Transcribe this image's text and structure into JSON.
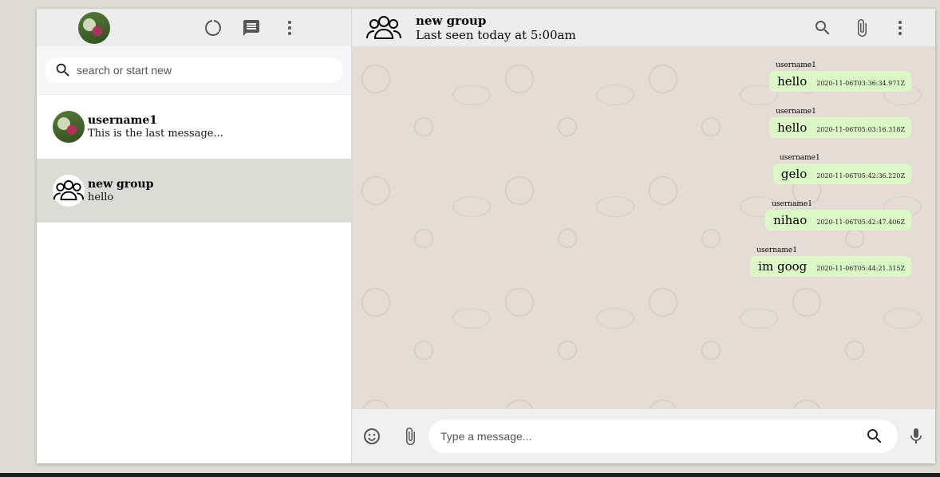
{
  "sidebar": {
    "search": {
      "placeholder": "search or start new"
    },
    "chats": [
      {
        "name": "username1",
        "last_message": "This is the last message..."
      },
      {
        "name": "new group",
        "last_message": "hello"
      }
    ]
  },
  "conversation": {
    "title": "new group",
    "status": "Last seen today at 5:00am",
    "messages": [
      {
        "user": "username1",
        "text": "hello",
        "time": "2020-11-06T03:36:34.971Z"
      },
      {
        "user": "username1",
        "text": "hello",
        "time": "2020-11-06T05:03:16.318Z"
      },
      {
        "user": "username1",
        "text": "gelo",
        "time": "2020-11-06T05:42:36.220Z"
      },
      {
        "user": "username1",
        "text": "nihao",
        "time": "2020-11-06T05:42:47.406Z"
      },
      {
        "user": "username1",
        "text": "im goog",
        "time": "2020-11-06T05:44:21.315Z"
      }
    ]
  },
  "composer": {
    "placeholder": "Type a message..."
  },
  "colors": {
    "outgoing_bubble": "#dcf8c6",
    "header_bg": "#ededed",
    "active_chat": "#dcdcd6"
  },
  "icons": [
    "status-icon",
    "chat-icon",
    "menu-icon",
    "search-icon",
    "attach-icon",
    "emoji-icon",
    "mic-icon"
  ]
}
